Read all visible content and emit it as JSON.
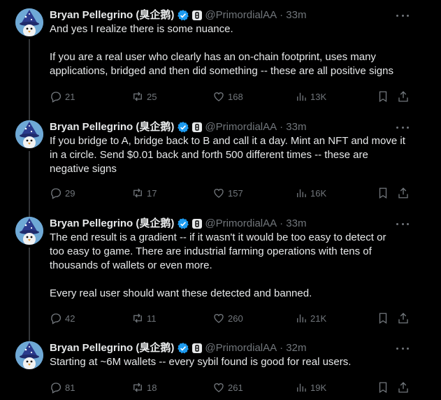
{
  "author": {
    "name": "Bryan Pellegrino (臭企鹅)",
    "handle": "@PrimordialAA",
    "colors": {
      "verified": "#1d9bf0",
      "text": "#e7e9ea",
      "muted": "#71767b",
      "background": "#000000"
    }
  },
  "tweets": [
    {
      "time": "· 33m",
      "lines": [
        "And yes I realize there is some nuance.",
        "",
        "If you are a real user who clearly has an on-chain footprint, uses many",
        "applications, bridged and then did something -- these are all positive signs"
      ],
      "replies": "21",
      "retweets": "25",
      "likes": "168",
      "views": "13K"
    },
    {
      "time": "· 33m",
      "lines": [
        "If you bridge to A, bridge back to B and call it a day. Mint an NFT and move it",
        "in a circle. Send $0.01 back and forth 500 different times -- these are",
        "negative signs"
      ],
      "replies": "29",
      "retweets": "17",
      "likes": "157",
      "views": "16K"
    },
    {
      "time": "· 33m",
      "lines": [
        "The end result is a gradient -- if it wasn't it would be too easy to detect or",
        "too easy to game. There are industrial farming operations with tens of",
        "thousands of wallets or even more.",
        "",
        "Every real user should want these detected and banned."
      ],
      "replies": "42",
      "retweets": "11",
      "likes": "260",
      "views": "21K"
    },
    {
      "time": "· 32m",
      "lines": [
        "Starting at ~6M wallets -- every sybil found is good for real users."
      ],
      "replies": "81",
      "retweets": "18",
      "likes": "261",
      "views": "19K"
    }
  ]
}
